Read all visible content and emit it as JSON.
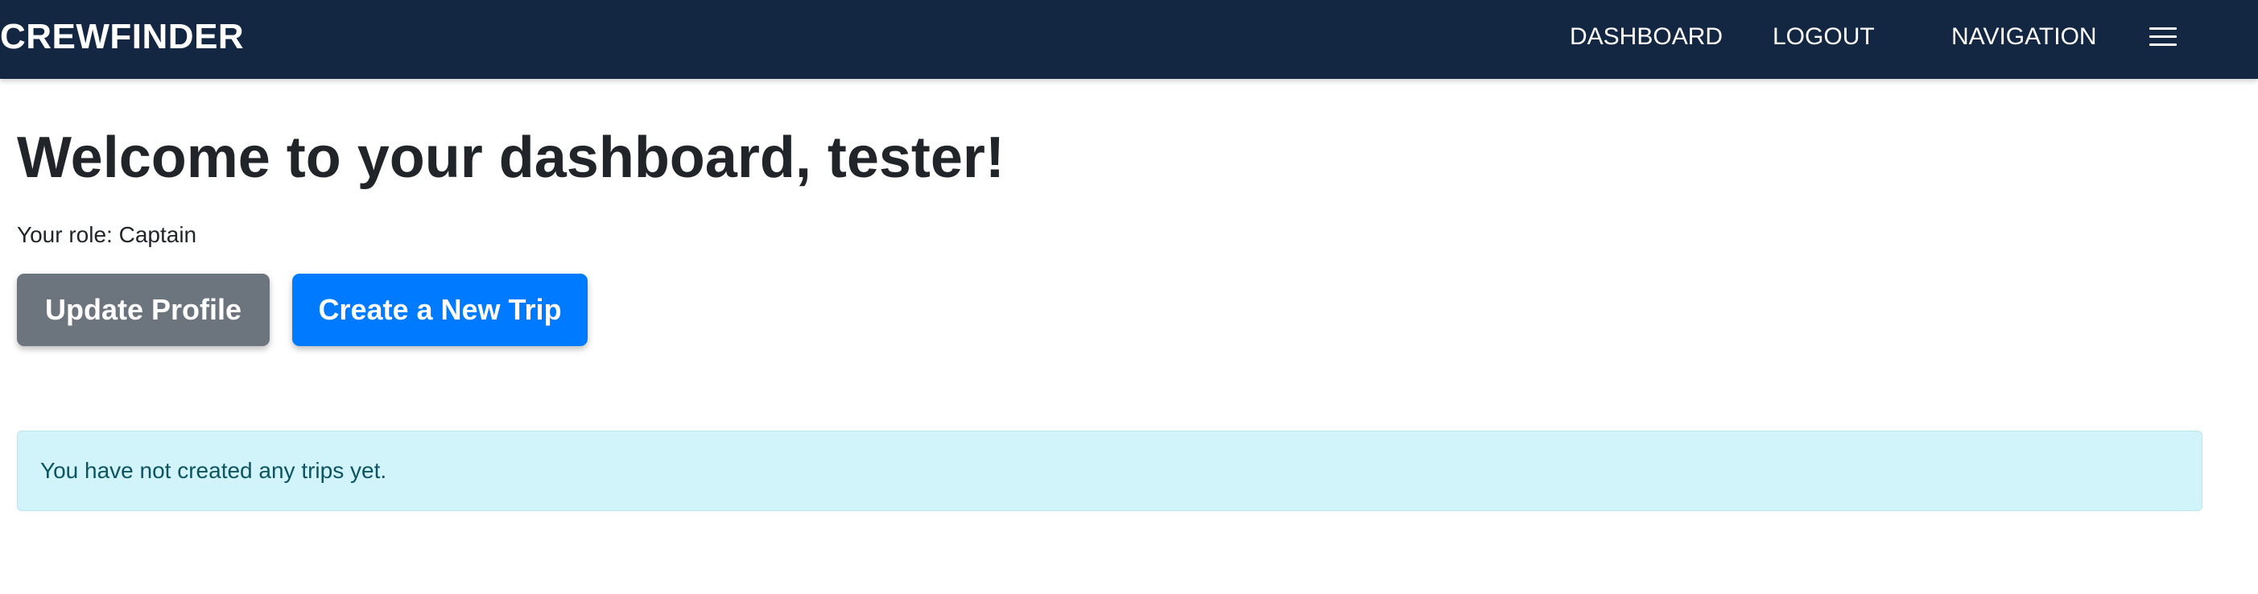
{
  "navbar": {
    "brand": "CREWFINDER",
    "links": {
      "dashboard": "DASHBOARD",
      "logout": "LOGOUT",
      "navigation": "NAVIGATION"
    },
    "menu_icon": "hamburger-menu-icon",
    "background_color": "#132742"
  },
  "main": {
    "title": "Welcome to your dashboard, tester!",
    "role_line": "Your role: Captain",
    "buttons": {
      "update_profile": "Update Profile",
      "create_trip": "Create a New Trip"
    },
    "alert": "You have not created any trips yet."
  },
  "colors": {
    "secondary": "#6c757d",
    "primary": "#007bff",
    "info_alert_bg": "#d1f3fa",
    "info_alert_text": "#0c5460"
  }
}
